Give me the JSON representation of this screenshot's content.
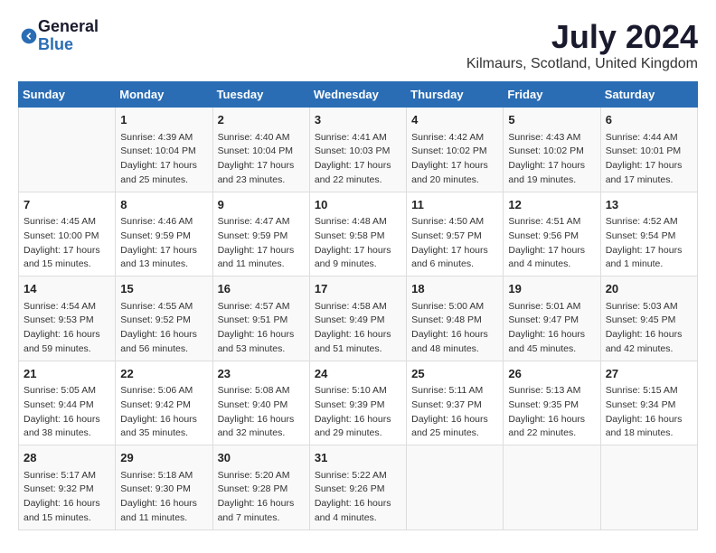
{
  "header": {
    "logo_general": "General",
    "logo_blue": "Blue",
    "title": "July 2024",
    "location": "Kilmaurs, Scotland, United Kingdom"
  },
  "days_of_week": [
    "Sunday",
    "Monday",
    "Tuesday",
    "Wednesday",
    "Thursday",
    "Friday",
    "Saturday"
  ],
  "weeks": [
    [
      {
        "day": "",
        "content": ""
      },
      {
        "day": "1",
        "content": "Sunrise: 4:39 AM\nSunset: 10:04 PM\nDaylight: 17 hours\nand 25 minutes."
      },
      {
        "day": "2",
        "content": "Sunrise: 4:40 AM\nSunset: 10:04 PM\nDaylight: 17 hours\nand 23 minutes."
      },
      {
        "day": "3",
        "content": "Sunrise: 4:41 AM\nSunset: 10:03 PM\nDaylight: 17 hours\nand 22 minutes."
      },
      {
        "day": "4",
        "content": "Sunrise: 4:42 AM\nSunset: 10:02 PM\nDaylight: 17 hours\nand 20 minutes."
      },
      {
        "day": "5",
        "content": "Sunrise: 4:43 AM\nSunset: 10:02 PM\nDaylight: 17 hours\nand 19 minutes."
      },
      {
        "day": "6",
        "content": "Sunrise: 4:44 AM\nSunset: 10:01 PM\nDaylight: 17 hours\nand 17 minutes."
      }
    ],
    [
      {
        "day": "7",
        "content": "Sunrise: 4:45 AM\nSunset: 10:00 PM\nDaylight: 17 hours\nand 15 minutes."
      },
      {
        "day": "8",
        "content": "Sunrise: 4:46 AM\nSunset: 9:59 PM\nDaylight: 17 hours\nand 13 minutes."
      },
      {
        "day": "9",
        "content": "Sunrise: 4:47 AM\nSunset: 9:59 PM\nDaylight: 17 hours\nand 11 minutes."
      },
      {
        "day": "10",
        "content": "Sunrise: 4:48 AM\nSunset: 9:58 PM\nDaylight: 17 hours\nand 9 minutes."
      },
      {
        "day": "11",
        "content": "Sunrise: 4:50 AM\nSunset: 9:57 PM\nDaylight: 17 hours\nand 6 minutes."
      },
      {
        "day": "12",
        "content": "Sunrise: 4:51 AM\nSunset: 9:56 PM\nDaylight: 17 hours\nand 4 minutes."
      },
      {
        "day": "13",
        "content": "Sunrise: 4:52 AM\nSunset: 9:54 PM\nDaylight: 17 hours\nand 1 minute."
      }
    ],
    [
      {
        "day": "14",
        "content": "Sunrise: 4:54 AM\nSunset: 9:53 PM\nDaylight: 16 hours\nand 59 minutes."
      },
      {
        "day": "15",
        "content": "Sunrise: 4:55 AM\nSunset: 9:52 PM\nDaylight: 16 hours\nand 56 minutes."
      },
      {
        "day": "16",
        "content": "Sunrise: 4:57 AM\nSunset: 9:51 PM\nDaylight: 16 hours\nand 53 minutes."
      },
      {
        "day": "17",
        "content": "Sunrise: 4:58 AM\nSunset: 9:49 PM\nDaylight: 16 hours\nand 51 minutes."
      },
      {
        "day": "18",
        "content": "Sunrise: 5:00 AM\nSunset: 9:48 PM\nDaylight: 16 hours\nand 48 minutes."
      },
      {
        "day": "19",
        "content": "Sunrise: 5:01 AM\nSunset: 9:47 PM\nDaylight: 16 hours\nand 45 minutes."
      },
      {
        "day": "20",
        "content": "Sunrise: 5:03 AM\nSunset: 9:45 PM\nDaylight: 16 hours\nand 42 minutes."
      }
    ],
    [
      {
        "day": "21",
        "content": "Sunrise: 5:05 AM\nSunset: 9:44 PM\nDaylight: 16 hours\nand 38 minutes."
      },
      {
        "day": "22",
        "content": "Sunrise: 5:06 AM\nSunset: 9:42 PM\nDaylight: 16 hours\nand 35 minutes."
      },
      {
        "day": "23",
        "content": "Sunrise: 5:08 AM\nSunset: 9:40 PM\nDaylight: 16 hours\nand 32 minutes."
      },
      {
        "day": "24",
        "content": "Sunrise: 5:10 AM\nSunset: 9:39 PM\nDaylight: 16 hours\nand 29 minutes."
      },
      {
        "day": "25",
        "content": "Sunrise: 5:11 AM\nSunset: 9:37 PM\nDaylight: 16 hours\nand 25 minutes."
      },
      {
        "day": "26",
        "content": "Sunrise: 5:13 AM\nSunset: 9:35 PM\nDaylight: 16 hours\nand 22 minutes."
      },
      {
        "day": "27",
        "content": "Sunrise: 5:15 AM\nSunset: 9:34 PM\nDaylight: 16 hours\nand 18 minutes."
      }
    ],
    [
      {
        "day": "28",
        "content": "Sunrise: 5:17 AM\nSunset: 9:32 PM\nDaylight: 16 hours\nand 15 minutes."
      },
      {
        "day": "29",
        "content": "Sunrise: 5:18 AM\nSunset: 9:30 PM\nDaylight: 16 hours\nand 11 minutes."
      },
      {
        "day": "30",
        "content": "Sunrise: 5:20 AM\nSunset: 9:28 PM\nDaylight: 16 hours\nand 7 minutes."
      },
      {
        "day": "31",
        "content": "Sunrise: 5:22 AM\nSunset: 9:26 PM\nDaylight: 16 hours\nand 4 minutes."
      },
      {
        "day": "",
        "content": ""
      },
      {
        "day": "",
        "content": ""
      },
      {
        "day": "",
        "content": ""
      }
    ]
  ]
}
